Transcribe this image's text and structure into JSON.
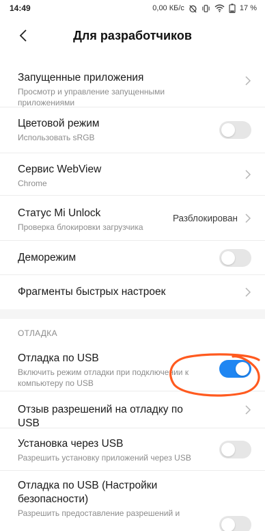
{
  "status": {
    "time": "14:49",
    "speed": "0,00 КБ/с",
    "battery": "17 %",
    "icons": [
      "alarm-off-icon",
      "vibrate-icon",
      "wifi-icon",
      "battery-icon"
    ]
  },
  "header": {
    "title": "Для разработчиков",
    "back_icon": "back-arrow-icon"
  },
  "rows": {
    "running_apps": {
      "title": "Запущенные приложения",
      "subtitle": "Просмотр и управление запущенными приложениями"
    },
    "color_mode": {
      "title": "Цветовой режим",
      "subtitle": "Использовать sRGB",
      "toggle": false
    },
    "webview": {
      "title": "Сервис WebView",
      "subtitle": "Chrome"
    },
    "mi_unlock": {
      "title": "Статус Mi Unlock",
      "subtitle": "Проверка блокировки загрузчика",
      "value": "Разблокирован"
    },
    "demo_mode": {
      "title": "Деморежим",
      "toggle": false
    },
    "quick_tiles": {
      "title": "Фрагменты быстрых настроек"
    }
  },
  "section": {
    "label": "ОТЛАДКА"
  },
  "debug_rows": {
    "usb_debug": {
      "title": "Отладка по USB",
      "subtitle": "Включить режим отладки при подключении к компьютеру по USB",
      "toggle": true
    },
    "revoke": {
      "title": "Отзыв разрешений на отладку по USB"
    },
    "install_usb": {
      "title": "Установка через USB",
      "subtitle": "Разрешить установку приложений через USB",
      "toggle": false
    },
    "usb_security": {
      "title": "Отладка по USB (Настройки безопасности)",
      "subtitle": "Разрешить предоставление разрешений и",
      "toggle": false
    }
  },
  "colors": {
    "accent": "#1f86f2",
    "annotation": "#ff5a1f",
    "toggle_off": "#e6e6e6"
  }
}
